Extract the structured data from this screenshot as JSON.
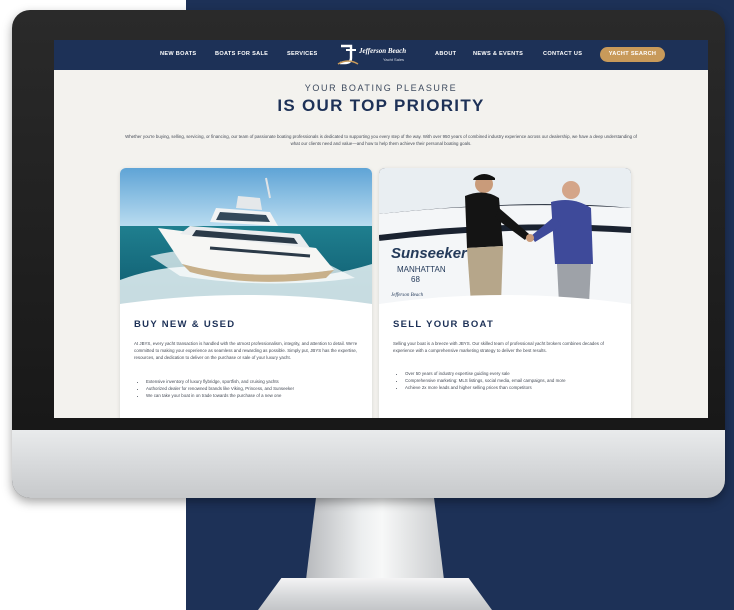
{
  "nav": {
    "items": [
      "NEW BOATS",
      "BOATS FOR SALE",
      "SERVICES",
      "ABOUT",
      "NEWS & EVENTS",
      "CONTACT US"
    ],
    "cta_label": "YACHT SEARCH",
    "logo": {
      "name": "Jefferson Beach",
      "tagline": "Yacht Sales"
    }
  },
  "hero": {
    "kicker": "YOUR BOATING PLEASURE",
    "headline": "IS OUR TOP PRIORITY",
    "intro": "Whether you're buying, selling, servicing, or financing, our team of passionate boating professionals is dedicated to supporting you every step of the way. With over 950 years of combined industry experience across our dealership, we have a deep understanding of what our clients need and value—and how to help them achieve their personal boating goals."
  },
  "cards": [
    {
      "title": "BUY NEW & USED",
      "body": "At JBYS, every yacht transaction is handled with the utmost professionalism, integrity, and attention to detail. We're committed to making your experience as seamless and rewarding as possible. Simply put, JBYS has the expertise, resources, and dedication to deliver on the purchase or sale of your luxury yacht.",
      "bullets": [
        "Extensive inventory of luxury flybridge, sportfish, and cruising yachts",
        "Authorized dealer for renowned brands like Viking, Princess, and Sunseeker",
        "We can take your boat in on trade towards the purchase of a new one"
      ]
    },
    {
      "title": "SELL YOUR BOAT",
      "body": "Selling your boat is a breeze with JBYS. Our skilled team of professional yacht brokers combines decades of experience with a comprehensive marketing strategy to deliver the best results.",
      "bullets": [
        "Over 50 years of industry expertise guiding every sale",
        "Comprehensive marketing: MLS listings, social media, email campaigns, and more",
        "Achieve 2x more leads and higher selling prices than competitors"
      ],
      "hull_text": [
        "Sunseeker",
        "MANHATTAN",
        "68",
        "Jefferson Beach"
      ]
    }
  ],
  "colors": {
    "navy": "#1d3157",
    "gold": "#c89a5a",
    "screen_bg": "#f3f2ee"
  }
}
